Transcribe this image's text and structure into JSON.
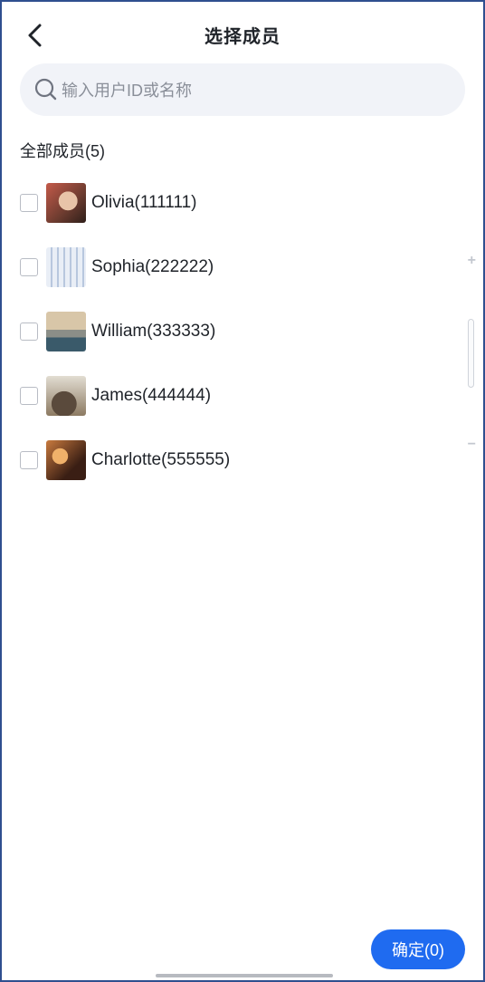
{
  "header": {
    "title": "选择成员",
    "back_icon": "chevron-left-icon"
  },
  "search": {
    "placeholder": "输入用户ID或名称",
    "icon": "search-icon"
  },
  "section": {
    "label": "全部成员(5)"
  },
  "members": [
    {
      "label": "Olivia(111111)",
      "checked": false,
      "avatar_colors": [
        "#6b3b2f",
        "#e8c4a8",
        "#c45a4a"
      ]
    },
    {
      "label": "Sophia(222222)",
      "checked": false,
      "avatar_colors": [
        "#e9eef6",
        "#b8c7de",
        "#f3d9d0"
      ]
    },
    {
      "label": "William(333333)",
      "checked": false,
      "avatar_colors": [
        "#c9b79a",
        "#6e7f86",
        "#3a5a6a"
      ]
    },
    {
      "label": "James(444444)",
      "checked": false,
      "avatar_colors": [
        "#d9d4c8",
        "#8c7a62",
        "#3d3a36"
      ]
    },
    {
      "label": "Charlotte(555555)",
      "checked": false,
      "avatar_colors": [
        "#3a1e14",
        "#c97a3e",
        "#f0b16a"
      ]
    }
  ],
  "scroll_controls": {
    "plus_label": "+",
    "minus_label": "−"
  },
  "footer": {
    "confirm_label": "确定(0)"
  },
  "colors": {
    "accent": "#1f6bf0",
    "search_bg": "#f1f3f8",
    "frame_border": "#2f4f8f"
  }
}
